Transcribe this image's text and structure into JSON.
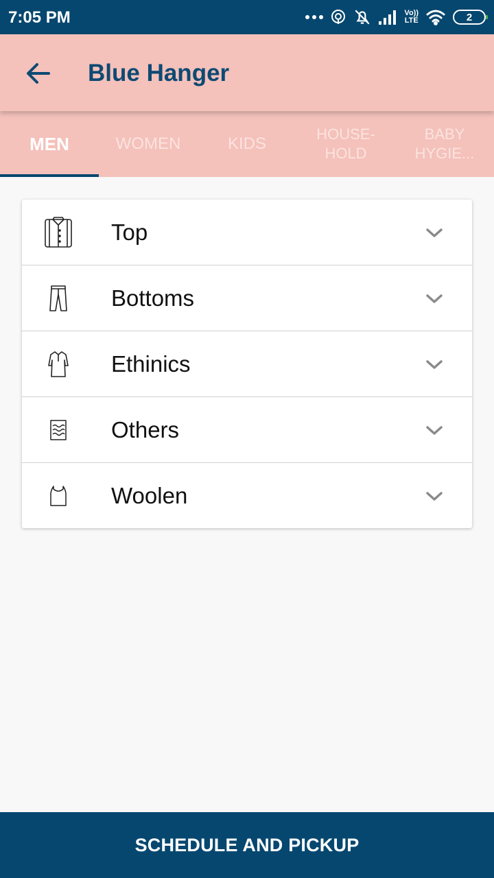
{
  "status_bar": {
    "time": "7:05 PM",
    "volte_top": "Vo))",
    "volte_bottom": "LTE",
    "battery_level": "2"
  },
  "app_bar": {
    "title": "Blue Hanger",
    "back_icon": "arrow-left-icon"
  },
  "tabs": [
    {
      "label": "MEN",
      "active": true
    },
    {
      "label": "WOMEN",
      "active": false
    },
    {
      "label": "KIDS",
      "active": false
    },
    {
      "label": "HOUSE-\nHOLD",
      "active": false
    },
    {
      "label": "BABY\nHYGIE...",
      "active": false
    }
  ],
  "categories": [
    {
      "label": "Top",
      "icon": "shirt-icon"
    },
    {
      "label": "Bottoms",
      "icon": "trousers-icon"
    },
    {
      "label": "Ethinics",
      "icon": "kurta-icon"
    },
    {
      "label": "Others",
      "icon": "towel-icon"
    },
    {
      "label": "Woolen",
      "icon": "vest-icon"
    }
  ],
  "footer": {
    "button_label": "SCHEDULE AND PICKUP"
  },
  "colors": {
    "primary": "#06476f",
    "header_bg": "#f4c1bb",
    "title_color": "#0d4a73"
  }
}
